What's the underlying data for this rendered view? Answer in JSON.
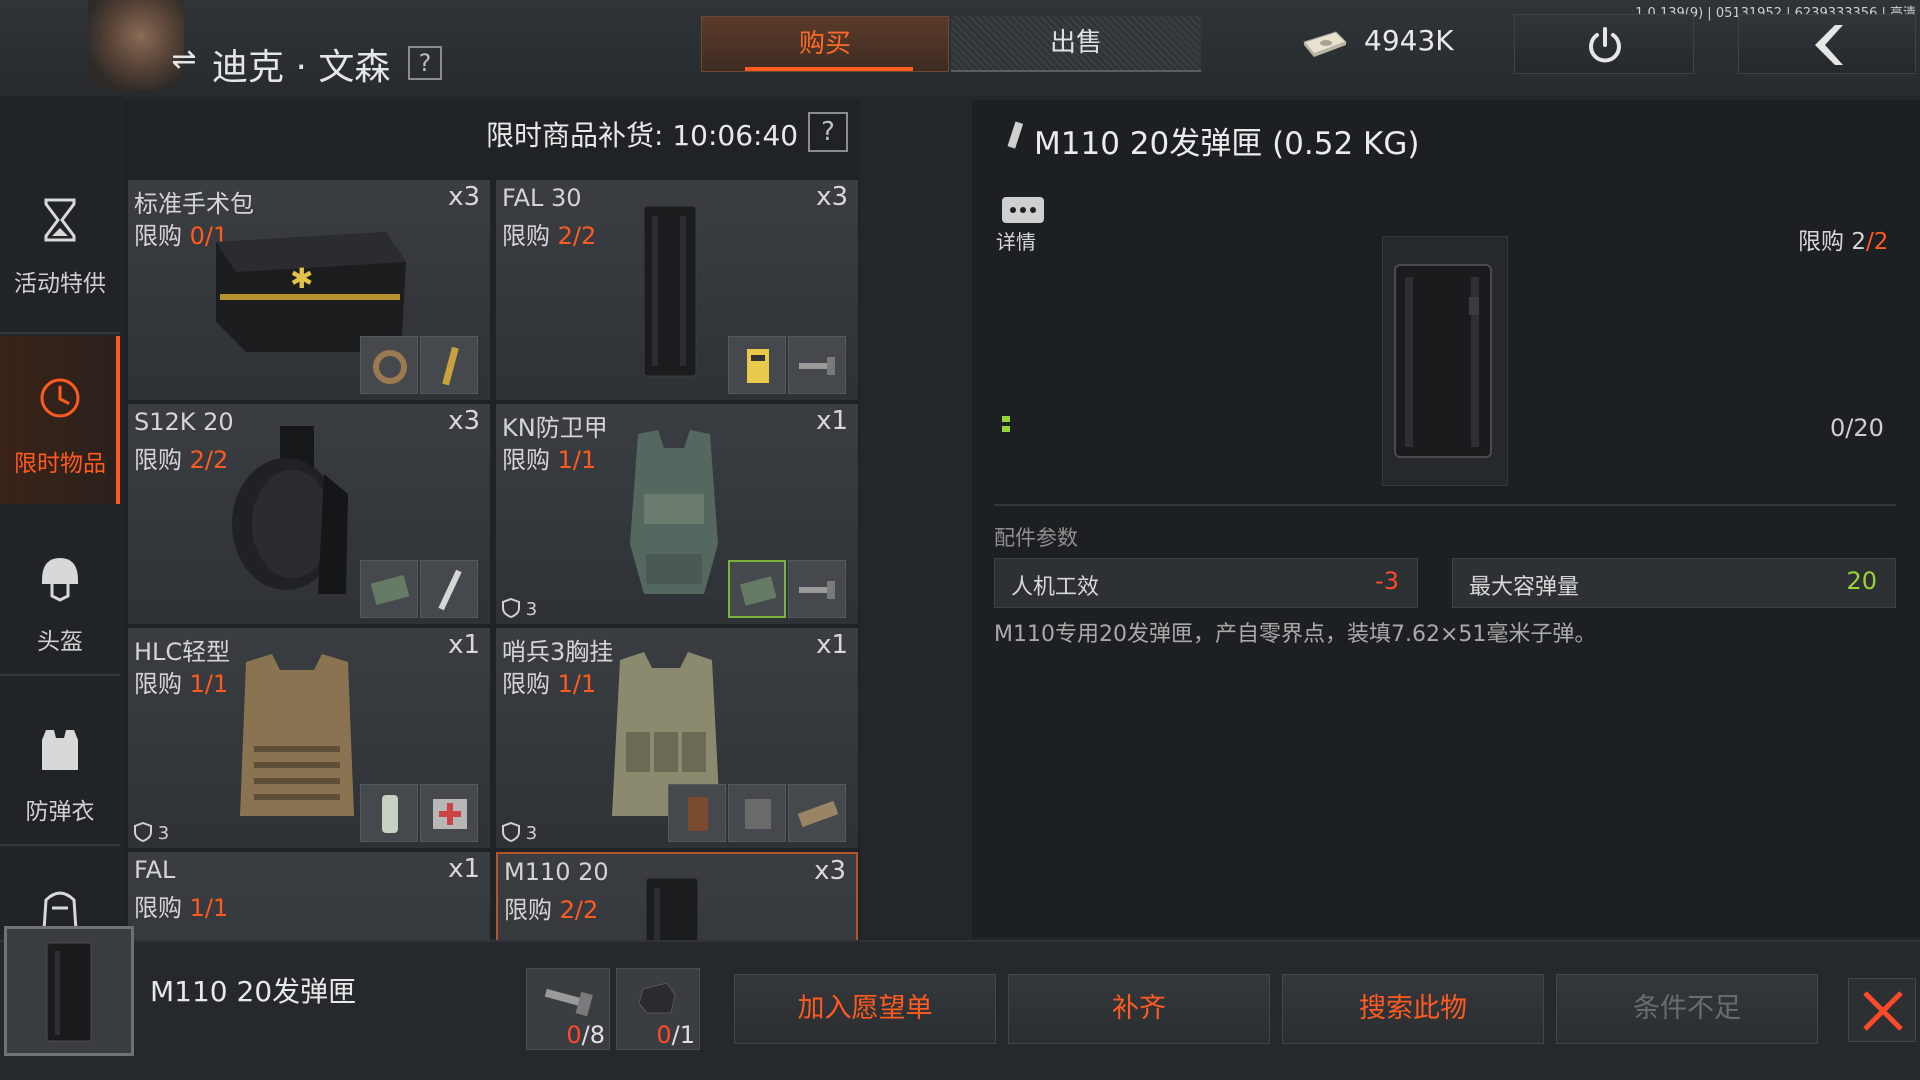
{
  "version": "1.0.139(9) | 05131952 | 6239333356 | 高清",
  "header": {
    "character_name": "迪克 · 文森",
    "help": "?",
    "tabs": {
      "buy": "购买",
      "sell": "出售"
    },
    "cash": "4943K"
  },
  "sidebar": {
    "items": [
      {
        "label": "活动特供",
        "icon": "hourglass-icon"
      },
      {
        "label": "限时物品",
        "icon": "clock-icon",
        "active": true
      },
      {
        "label": "头盔",
        "icon": "helmet-icon"
      },
      {
        "label": "防弹衣",
        "icon": "vest-icon"
      },
      {
        "label": "",
        "icon": "backpack-icon"
      }
    ]
  },
  "grid": {
    "restock_label": "限时商品补货: 10:06:40",
    "help": "?",
    "limit_word": "限购",
    "items": [
      {
        "name": "标准手术包",
        "limit_cur": "0",
        "limit_max": "/1",
        "qty": "x3",
        "armor": ""
      },
      {
        "name": "FAL 30",
        "limit_cur": "2",
        "limit_max": "/2",
        "qty": "x3",
        "armor": ""
      },
      {
        "name": "S12K 20",
        "limit_cur": "2",
        "limit_max": "/2",
        "qty": "x3",
        "armor": ""
      },
      {
        "name": "KN防卫甲",
        "limit_cur": "1",
        "limit_max": "/1",
        "qty": "x1",
        "armor": "3"
      },
      {
        "name": "HLC轻型",
        "limit_cur": "1",
        "limit_max": "/1",
        "qty": "x1",
        "armor": "3"
      },
      {
        "name": "哨兵3胸挂",
        "limit_cur": "1",
        "limit_max": "/1",
        "qty": "x1",
        "armor": "3"
      },
      {
        "name": "FAL",
        "limit_cur": "1",
        "limit_max": "/1",
        "qty": "x1",
        "armor": ""
      },
      {
        "name": "M110 20",
        "limit_cur": "2",
        "limit_max": "/2",
        "qty": "x3",
        "armor": ""
      }
    ]
  },
  "detail": {
    "title": "M110 20发弹匣 (0.52 KG)",
    "info_label": "详情",
    "limit_label": "限购",
    "limit_cur": "2",
    "limit_max": "/2",
    "count": "0/20",
    "params_label": "配件参数",
    "params": [
      {
        "name": "人机工效",
        "value": "-3",
        "color": "#ff4a2a"
      },
      {
        "name": "最大容弹量",
        "value": "20",
        "color": "#9bd33b"
      }
    ],
    "description": "M110专用20发弹匣，产自零界点，装填7.62×51毫米子弹。"
  },
  "bottom": {
    "selected_name": "M110 20发弹匣",
    "requirements": [
      {
        "have": "0",
        "need": "/8",
        "icon": "screw-icon"
      },
      {
        "have": "0",
        "need": "/1",
        "icon": "mount-part-icon"
      }
    ],
    "buttons": {
      "wishlist": "加入愿望单",
      "restock": "补齐",
      "search": "搜索此物",
      "insufficient": "条件不足"
    }
  },
  "colors": {
    "accent": "#ff5a1f",
    "negative": "#ff4a2a",
    "positive": "#9bd33b"
  }
}
